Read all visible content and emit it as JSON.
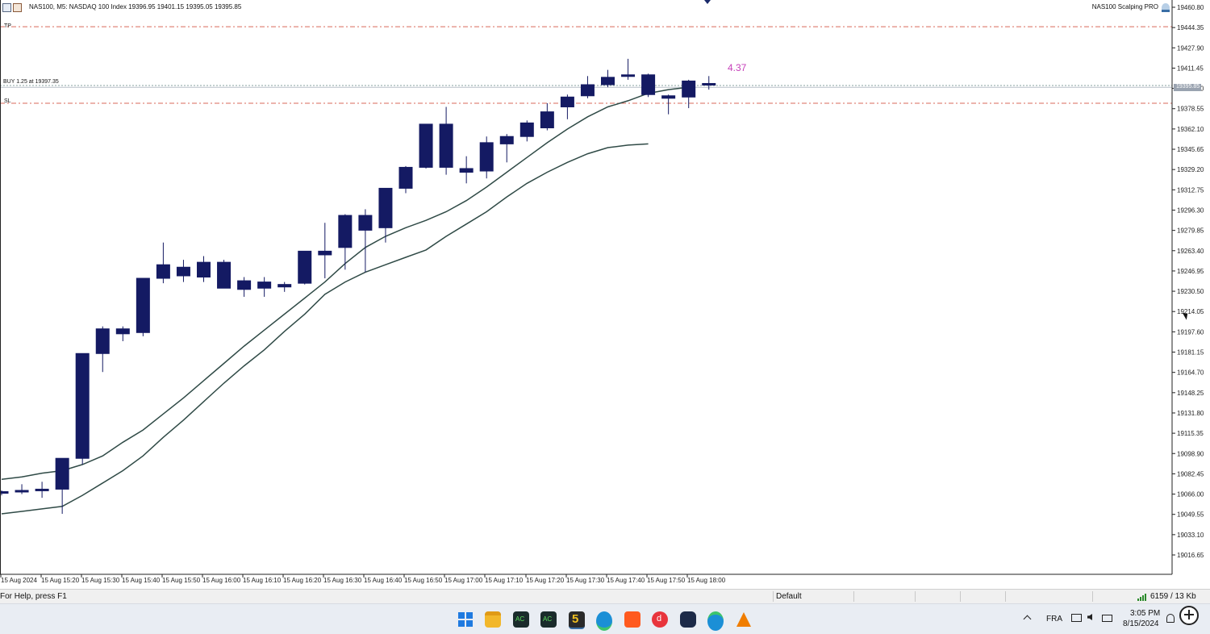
{
  "header": {
    "symbol_info": "NAS100, M5: NASDAQ 100 Index  19396.95 19401.15 19395.05 19395.85",
    "indicator_name": "NAS100 Scalping PRO"
  },
  "trade_labels": {
    "tp": "TP",
    "sl": "SL",
    "buy": "BUY 1.25 at 19397.35",
    "profit": "4.37",
    "current_price": "19395.85"
  },
  "colors": {
    "candle": "#141a63",
    "ma": "#2f4a46",
    "tp_sl_line": "#d96a5a",
    "buy_line": "#8aa3a0",
    "profit_text": "#c63fb9",
    "price_tag": "#9aa3b0"
  },
  "chart_data": {
    "type": "candlestick",
    "symbol": "NAS100",
    "timeframe": "M5",
    "ylim": [
      19000,
      19465
    ],
    "y_ticks": [
      "19460.80",
      "19444.35",
      "19427.90",
      "19411.45",
      "19395.00",
      "19378.55",
      "19362.10",
      "19345.65",
      "19329.20",
      "19312.75",
      "19296.30",
      "19279.85",
      "19263.40",
      "19246.95",
      "19230.50",
      "19214.05",
      "19197.60",
      "19181.15",
      "19164.70",
      "19148.25",
      "19131.80",
      "19115.35",
      "19098.90",
      "19082.45",
      "19066.00",
      "19049.55",
      "19033.10",
      "19016.65"
    ],
    "x_ticks": [
      "15 Aug 2024",
      "15 Aug 15:20",
      "15 Aug 15:30",
      "15 Aug 15:40",
      "15 Aug 15:50",
      "15 Aug 16:00",
      "15 Aug 16:10",
      "15 Aug 16:20",
      "15 Aug 16:30",
      "15 Aug 16:40",
      "15 Aug 16:50",
      "15 Aug 17:00",
      "15 Aug 17:10",
      "15 Aug 17:20",
      "15 Aug 17:30",
      "15 Aug 17:40",
      "15 Aug 17:50",
      "15 Aug 18:00"
    ],
    "levels": {
      "tp": 19445,
      "sl": 19383,
      "buy": 19397.35,
      "bid": 19395.85
    },
    "candles": [
      {
        "o": 19067,
        "h": 19069,
        "l": 19065,
        "c": 19068
      },
      {
        "o": 19068,
        "h": 19074,
        "l": 19066,
        "c": 19069
      },
      {
        "o": 19069,
        "h": 19076,
        "l": 19063,
        "c": 19070
      },
      {
        "o": 19070,
        "h": 19095,
        "l": 19050,
        "c": 19095
      },
      {
        "o": 19095,
        "h": 19180,
        "l": 19090,
        "c": 19180
      },
      {
        "o": 19180,
        "h": 19202,
        "l": 19165,
        "c": 19200
      },
      {
        "o": 19196,
        "h": 19202,
        "l": 19190,
        "c": 19200
      },
      {
        "o": 19197,
        "h": 19241,
        "l": 19194,
        "c": 19241
      },
      {
        "o": 19241,
        "h": 19270,
        "l": 19237,
        "c": 19252
      },
      {
        "o": 19250,
        "h": 19256,
        "l": 19238,
        "c": 19243
      },
      {
        "o": 19242,
        "h": 19259,
        "l": 19238,
        "c": 19254
      },
      {
        "o": 19254,
        "h": 19256,
        "l": 19233,
        "c": 19233
      },
      {
        "o": 19239,
        "h": 19242,
        "l": 19226,
        "c": 19232
      },
      {
        "o": 19233,
        "h": 19242,
        "l": 19226,
        "c": 19238
      },
      {
        "o": 19236,
        "h": 19238,
        "l": 19230,
        "c": 19234
      },
      {
        "o": 19237,
        "h": 19263,
        "l": 19236,
        "c": 19263
      },
      {
        "o": 19260,
        "h": 19286,
        "l": 19241,
        "c": 19263
      },
      {
        "o": 19266,
        "h": 19293,
        "l": 19248,
        "c": 19292
      },
      {
        "o": 19280,
        "h": 19297,
        "l": 19246,
        "c": 19292
      },
      {
        "o": 19282,
        "h": 19314,
        "l": 19270,
        "c": 19314
      },
      {
        "o": 19314,
        "h": 19332,
        "l": 19310,
        "c": 19331
      },
      {
        "o": 19331,
        "h": 19366,
        "l": 19330,
        "c": 19366
      },
      {
        "o": 19366,
        "h": 19380,
        "l": 19325,
        "c": 19331
      },
      {
        "o": 19330,
        "h": 19340,
        "l": 19318,
        "c": 19327
      },
      {
        "o": 19328,
        "h": 19356,
        "l": 19322,
        "c": 19351
      },
      {
        "o": 19350,
        "h": 19358,
        "l": 19335,
        "c": 19356
      },
      {
        "o": 19356,
        "h": 19369,
        "l": 19352,
        "c": 19367
      },
      {
        "o": 19363,
        "h": 19383,
        "l": 19361,
        "c": 19376
      },
      {
        "o": 19380,
        "h": 19390,
        "l": 19370,
        "c": 19388
      },
      {
        "o": 19389,
        "h": 19405,
        "l": 19387,
        "c": 19398
      },
      {
        "o": 19398,
        "h": 19410,
        "l": 19396,
        "c": 19404
      },
      {
        "o": 19406,
        "h": 19419,
        "l": 19402,
        "c": 19405
      },
      {
        "o": 19406,
        "h": 19407,
        "l": 19388,
        "c": 19390
      },
      {
        "o": 19387,
        "h": 19390,
        "l": 19374,
        "c": 19389
      },
      {
        "o": 19388,
        "h": 19402,
        "l": 19379,
        "c": 19401
      },
      {
        "o": 19399,
        "h": 19405,
        "l": 19394,
        "c": 19398
      }
    ],
    "ma_fast": [
      19078,
      19080,
      19083,
      19085,
      19090,
      19097,
      19108,
      19118,
      19131,
      19144,
      19158,
      19172,
      19186,
      19199,
      19212,
      19225,
      19238,
      19253,
      19266,
      19275,
      19282,
      19288,
      19295,
      19304,
      19315,
      19327,
      19339,
      19351,
      19362,
      19372,
      19380,
      19385,
      19391,
      19394,
      19396
    ],
    "ma_slow": [
      19050,
      19052,
      19054,
      19056,
      19065,
      19075,
      19085,
      19097,
      19112,
      19126,
      19141,
      19156,
      19170,
      19183,
      19198,
      19212,
      19228,
      19238,
      19246,
      19252,
      19258,
      19264,
      19275,
      19285,
      19295,
      19307,
      19318,
      19327,
      19335,
      19342,
      19347,
      19349,
      19350
    ]
  },
  "status_bar": {
    "help": "For Help, press F1",
    "profile": "Default",
    "traffic": "6159 / 13 Kb"
  },
  "taskbar": {
    "language": "FRA",
    "time": "3:05 PM",
    "date": "8/15/2024",
    "apps": [
      "start-icon",
      "file-explorer-icon",
      "mt-markets-icon",
      "mt-markets-2-icon",
      "mt5-icon",
      "edge-icon",
      "app-orange-icon",
      "app-red-icon",
      "app-dark-icon",
      "edge-dev-icon",
      "vlc-icon"
    ]
  }
}
